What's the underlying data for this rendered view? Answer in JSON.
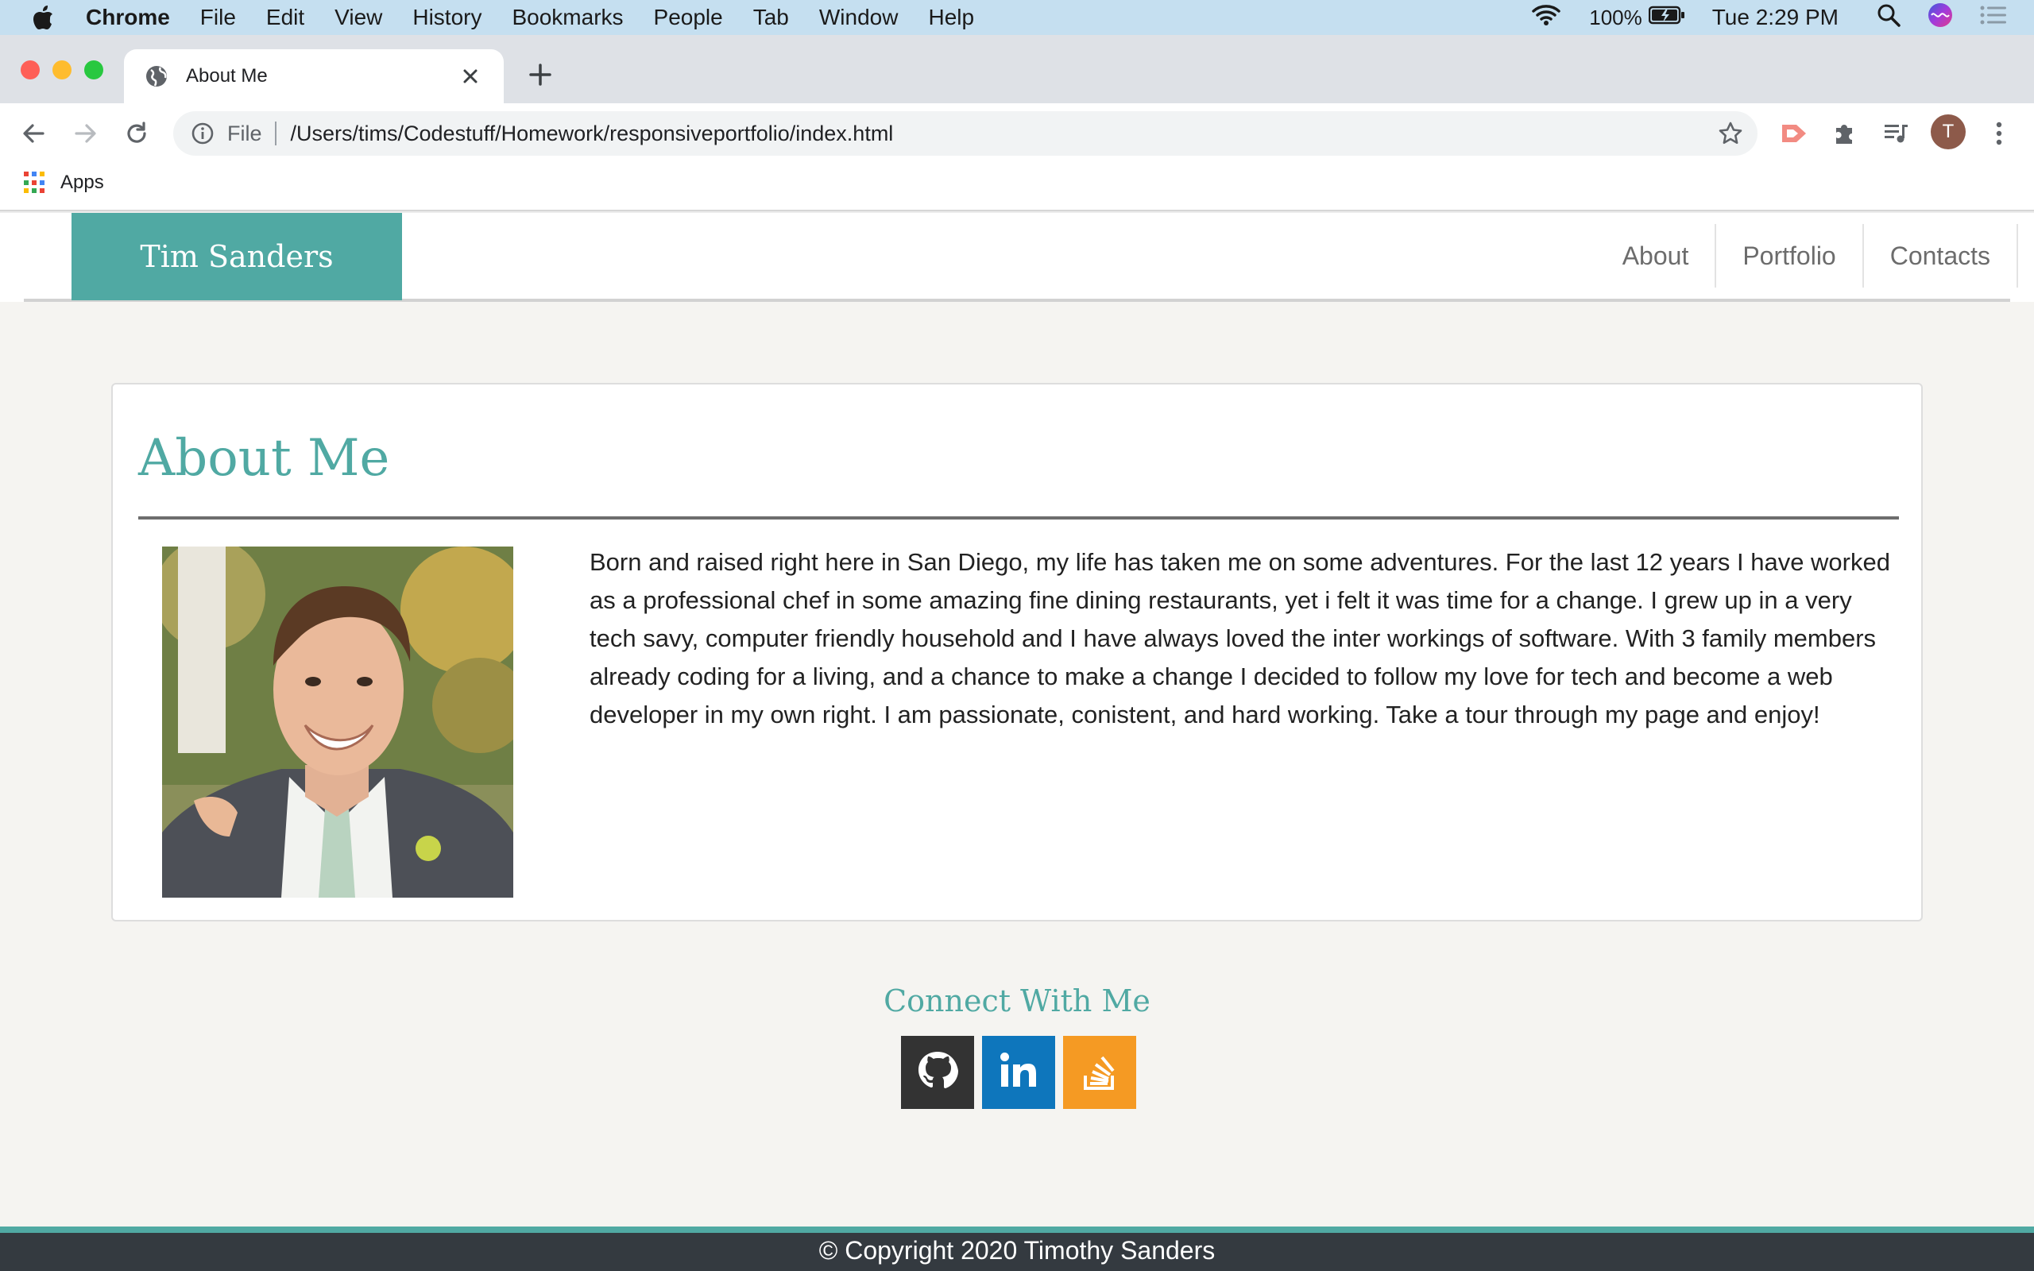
{
  "os_menubar": {
    "app_name": "Chrome",
    "menus": [
      "File",
      "Edit",
      "View",
      "History",
      "Bookmarks",
      "People",
      "Tab",
      "Window",
      "Help"
    ],
    "battery": "100%",
    "clock": "Tue 2:29 PM"
  },
  "browser": {
    "tab_title": "About Me",
    "scheme_label": "File",
    "url": "/Users/tims/Codestuff/Homework/responsiveportfolio/index.html",
    "profile_initial": "T",
    "bookmarks_apps_label": "Apps"
  },
  "site": {
    "brand": "Tim Sanders",
    "nav": [
      "About",
      "Portfolio",
      "Contacts"
    ],
    "accent_color": "#50a9a3",
    "about": {
      "heading": "About Me",
      "bio": "Born and raised right here in San Diego, my life has taken me on some adventures. For the last 12 years I have worked as a professional chef in some amazing fine dining restaurants, yet i felt it was time for a change. I grew up in a very tech savy, computer friendly household and I have always loved the inter workings of software. With 3 family members already coding for a living, and a chance to make a change I decided to follow my love for tech and become a web developer in my own right. I am passionate, conistent, and hard working. Take a tour through my page and enjoy!"
    },
    "connect": {
      "heading": "Connect With Me",
      "links": [
        {
          "icon": "github-icon",
          "color": "#333333"
        },
        {
          "icon": "linkedin-icon",
          "color": "#0e76bc"
        },
        {
          "icon": "stackoverflow-icon",
          "color": "#f59a23"
        }
      ]
    },
    "footer": "© Copyright 2020 Timothy Sanders"
  }
}
